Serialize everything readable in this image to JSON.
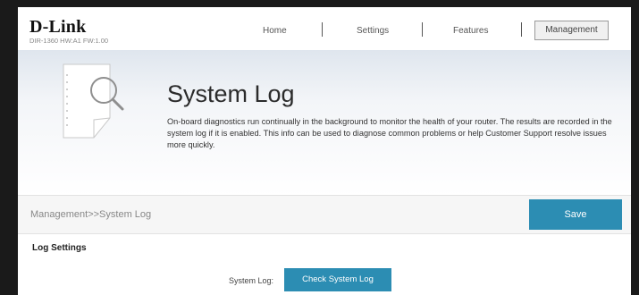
{
  "brand": {
    "logo": "D-Link",
    "model_info": "DIR-1360 HW:A1 FW:1.00"
  },
  "nav": {
    "items": [
      "Home",
      "Settings",
      "Features",
      "Management"
    ],
    "active": "Management"
  },
  "banner": {
    "title": "System Log",
    "description": "On-board diagnostics run continually in the background to monitor the health of your router. The results are recorded in the system log if it is enabled. This info can be used to diagnose common problems or help Customer Support resolve issues more quickly."
  },
  "breadcrumb": "Management>>System Log",
  "actions": {
    "save_label": "Save"
  },
  "log_settings": {
    "section_title": "Log Settings",
    "system_log_label": "System Log:",
    "check_button_label": "Check System Log"
  },
  "colors": {
    "accent": "#2c8db3",
    "text": "#333333"
  },
  "icons": {
    "banner": "magnifier-document-icon"
  }
}
